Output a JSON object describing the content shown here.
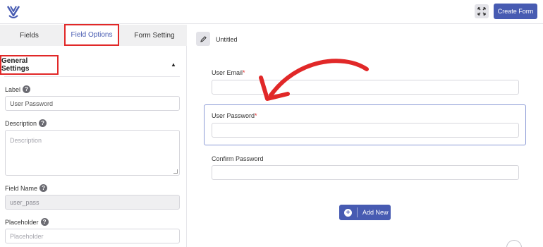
{
  "topbar": {
    "logo_icon": "brand-logo-icon",
    "expand_icon": "expand-icon",
    "create_form_label": "Create Form"
  },
  "tabs": {
    "fields": "Fields",
    "field_options": "Field Options",
    "form_setting": "Form Setting"
  },
  "general_settings": {
    "title": "General Settings",
    "caret": "▲"
  },
  "options": {
    "label": {
      "label": "Label",
      "value": "User Password"
    },
    "description": {
      "label": "Description",
      "placeholder": "Description"
    },
    "field_name": {
      "label": "Field Name",
      "value": "user_pass"
    },
    "placeholder": {
      "label": "Placeholder",
      "placeholder": "Placeholder"
    },
    "help_glyph": "?"
  },
  "form": {
    "title": "Untitled",
    "fields": [
      {
        "label": "User Email",
        "required": "*"
      },
      {
        "label": "User Password",
        "required": "*"
      },
      {
        "label": "Confirm Password",
        "required": ""
      }
    ],
    "add_new_label": "Add New",
    "add_glyph": "+"
  },
  "colors": {
    "accent": "#475bb2",
    "highlight": "#e12828"
  }
}
